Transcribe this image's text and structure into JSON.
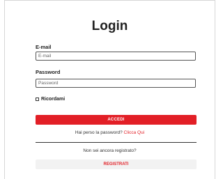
{
  "login": {
    "title": "Login",
    "email_label": "E-mail",
    "email_placeholder": "E-mail",
    "email_value": "",
    "password_label": "Password",
    "password_placeholder": "Password",
    "password_value": "",
    "remember_label": "Ricordami",
    "remember_checked": false,
    "submit_label": "ACCEDI",
    "forgot_text": "Hai perso la password?",
    "forgot_link": "Clicca Qui",
    "not_registered_text": "Non sei ancora registrato?",
    "register_label": "REGISTRATI"
  },
  "colors": {
    "accent": "#e21f26",
    "register_bg": "#f2f2f2",
    "border": "#d6d6d6"
  }
}
